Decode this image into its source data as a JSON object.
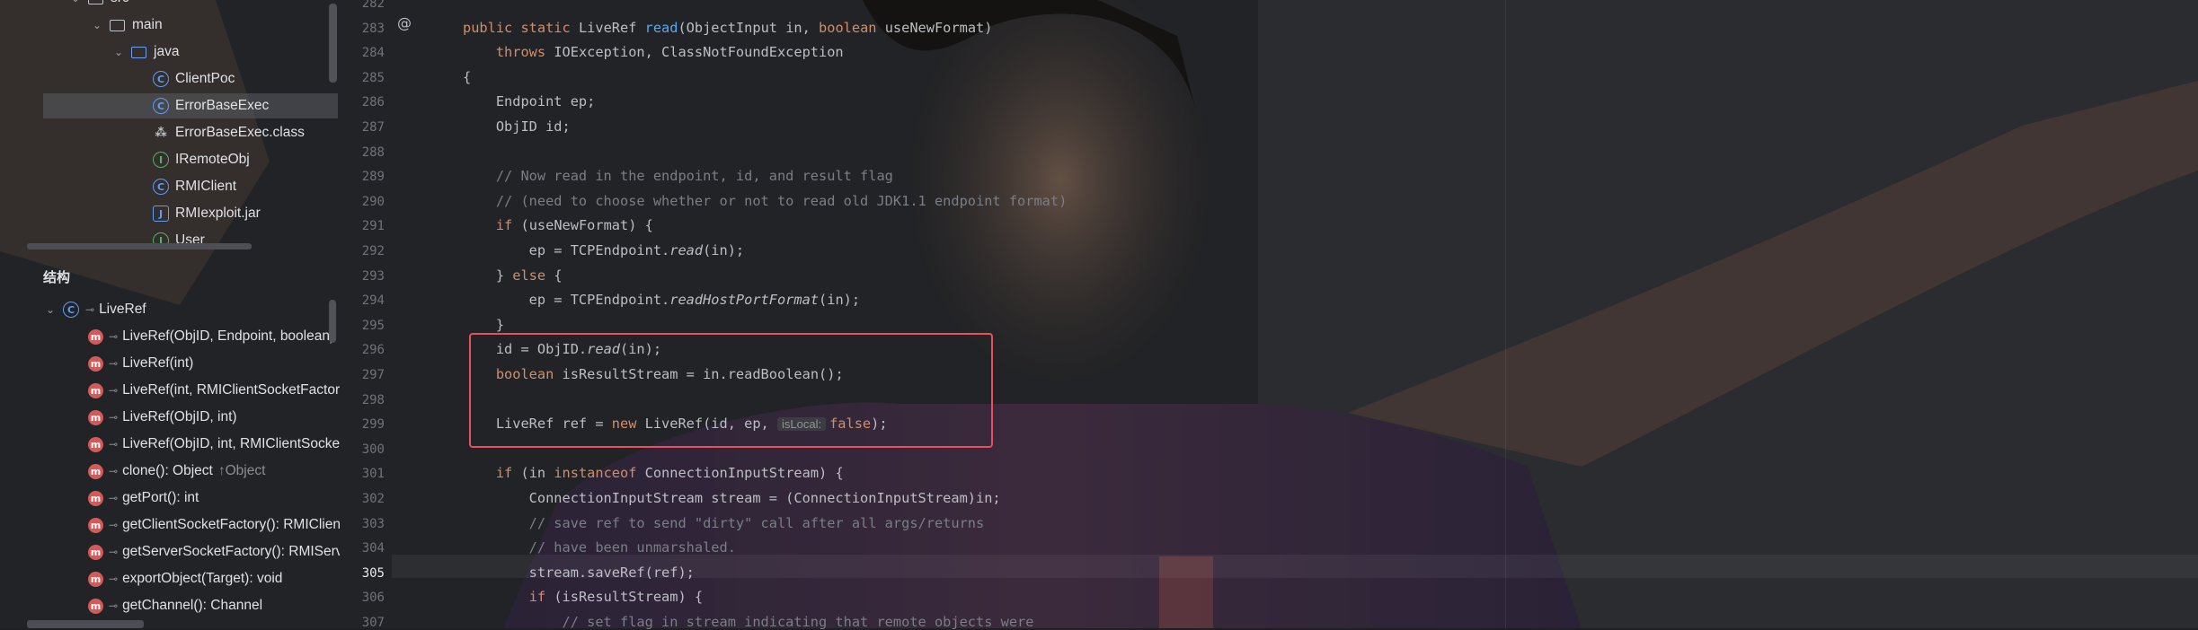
{
  "project_tree": {
    "items": [
      {
        "label": "src",
        "type": "folder",
        "chevron": "⌄"
      },
      {
        "label": "main",
        "type": "folder",
        "chevron": "⌄"
      },
      {
        "label": "java",
        "type": "folder-blue",
        "chevron": "⌄"
      },
      {
        "label": "ClientPoc",
        "type": "class"
      },
      {
        "label": "ErrorBaseExec",
        "type": "class",
        "selected": true
      },
      {
        "label": "ErrorBaseExec.class",
        "type": "binary"
      },
      {
        "label": "IRemoteObj",
        "type": "interface"
      },
      {
        "label": "RMIClient",
        "type": "class"
      },
      {
        "label": "RMIexploit.jar",
        "type": "jar"
      },
      {
        "label": "User",
        "type": "interface"
      }
    ]
  },
  "structure": {
    "title": "结构",
    "root": "LiveRef",
    "members": [
      {
        "name": "LiveRef(ObjID, Endpoint, boolean)",
        "type": ""
      },
      {
        "name": "LiveRef(int)",
        "type": ""
      },
      {
        "name": "LiveRef(int, RMIClientSocketFactory, RMIServerSocketFactory)",
        "type": ""
      },
      {
        "name": "LiveRef(ObjID, int)",
        "type": ""
      },
      {
        "name": "LiveRef(ObjID, int, RMIClientSocketFactory, RMIServerSocketFactory)",
        "type": ""
      },
      {
        "name": "clone(): Object",
        "type": "↑Object"
      },
      {
        "name": "getPort(): int",
        "type": ""
      },
      {
        "name": "getClientSocketFactory(): RMIClientSocketFactory",
        "type": ""
      },
      {
        "name": "getServerSocketFactory(): RMIServerSocketFactory",
        "type": ""
      },
      {
        "name": "exportObject(Target): void",
        "type": ""
      },
      {
        "name": "getChannel(): Channel",
        "type": ""
      }
    ]
  },
  "editor": {
    "line_numbers": [
      "282",
      "283",
      "284",
      "285",
      "286",
      "287",
      "288",
      "289",
      "290",
      "291",
      "292",
      "293",
      "294",
      "295",
      "296",
      "297",
      "298",
      "299",
      "300",
      "301",
      "302",
      "303",
      "304",
      "305",
      "306",
      "307"
    ],
    "current_line": "305",
    "inlay_hint": "isLocal:",
    "lines": [
      [],
      [
        {
          "c": "kw",
          "t": "public static "
        },
        {
          "c": "",
          "t": "LiveRef "
        },
        {
          "c": "fn",
          "t": "read"
        },
        {
          "c": "",
          "t": "(ObjectInput in, "
        },
        {
          "c": "kw",
          "t": "boolean "
        },
        {
          "c": "",
          "t": "useNewFormat)"
        }
      ],
      [
        {
          "c": "",
          "t": "    "
        },
        {
          "c": "kw",
          "t": "throws "
        },
        {
          "c": "",
          "t": "IOException, ClassNotFoundException"
        }
      ],
      [
        {
          "c": "",
          "t": "{"
        }
      ],
      [
        {
          "c": "",
          "t": "    Endpoint ep;"
        }
      ],
      [
        {
          "c": "",
          "t": "    ObjID id;"
        }
      ],
      [],
      [
        {
          "c": "cm",
          "t": "    // Now read in the endpoint, id, and result flag"
        }
      ],
      [
        {
          "c": "cm",
          "t": "    // (need to choose whether or not to read old JDK1.1 endpoint format)"
        }
      ],
      [
        {
          "c": "",
          "t": "    "
        },
        {
          "c": "kw",
          "t": "if "
        },
        {
          "c": "",
          "t": "(useNewFormat) {"
        }
      ],
      [
        {
          "c": "",
          "t": "        ep = TCPEndpoint."
        },
        {
          "c": "st",
          "t": "read"
        },
        {
          "c": "",
          "t": "(in);"
        }
      ],
      [
        {
          "c": "",
          "t": "    } "
        },
        {
          "c": "kw",
          "t": "else "
        },
        {
          "c": "",
          "t": "{"
        }
      ],
      [
        {
          "c": "",
          "t": "        ep = TCPEndpoint."
        },
        {
          "c": "st",
          "t": "readHostPortFormat"
        },
        {
          "c": "",
          "t": "(in);"
        }
      ],
      [
        {
          "c": "",
          "t": "    }"
        }
      ],
      [
        {
          "c": "",
          "t": "    id = ObjID."
        },
        {
          "c": "st",
          "t": "read"
        },
        {
          "c": "",
          "t": "(in);"
        }
      ],
      [
        {
          "c": "",
          "t": "    "
        },
        {
          "c": "kw",
          "t": "boolean "
        },
        {
          "c": "",
          "t": "isResultStream = in.readBoolean();"
        }
      ],
      [],
      [
        {
          "c": "",
          "t": "    LiveRef ref = "
        },
        {
          "c": "kw",
          "t": "new "
        },
        {
          "c": "",
          "t": "LiveRef(id, ep, "
        },
        {
          "c": "hint",
          "t": "isLocal:"
        },
        {
          "c": "kw",
          "t": "false"
        },
        {
          "c": "",
          "t": ");"
        }
      ],
      [],
      [
        {
          "c": "",
          "t": "    "
        },
        {
          "c": "kw",
          "t": "if "
        },
        {
          "c": "",
          "t": "(in "
        },
        {
          "c": "kw",
          "t": "instanceof "
        },
        {
          "c": "",
          "t": "ConnectionInputStream) {"
        }
      ],
      [
        {
          "c": "",
          "t": "        ConnectionInputStream stream = (ConnectionInputStream)in;"
        }
      ],
      [
        {
          "c": "cm",
          "t": "        // save ref to send \"dirty\" call after all args/returns"
        }
      ],
      [
        {
          "c": "cm",
          "t": "        // have been unmarshaled."
        }
      ],
      [
        {
          "c": "",
          "t": "        stream.saveRef(ref);"
        }
      ],
      [
        {
          "c": "",
          "t": "        "
        },
        {
          "c": "kw",
          "t": "if "
        },
        {
          "c": "",
          "t": "(isResultStream) {"
        }
      ],
      [
        {
          "c": "cm",
          "t": "            // set flag in stream indicating that remote objects were"
        }
      ]
    ]
  },
  "colors": {
    "accent_red": "#e8505b",
    "keyword": "#cf8e6d",
    "function": "#56a8f5",
    "comment": "#7a7e85"
  }
}
